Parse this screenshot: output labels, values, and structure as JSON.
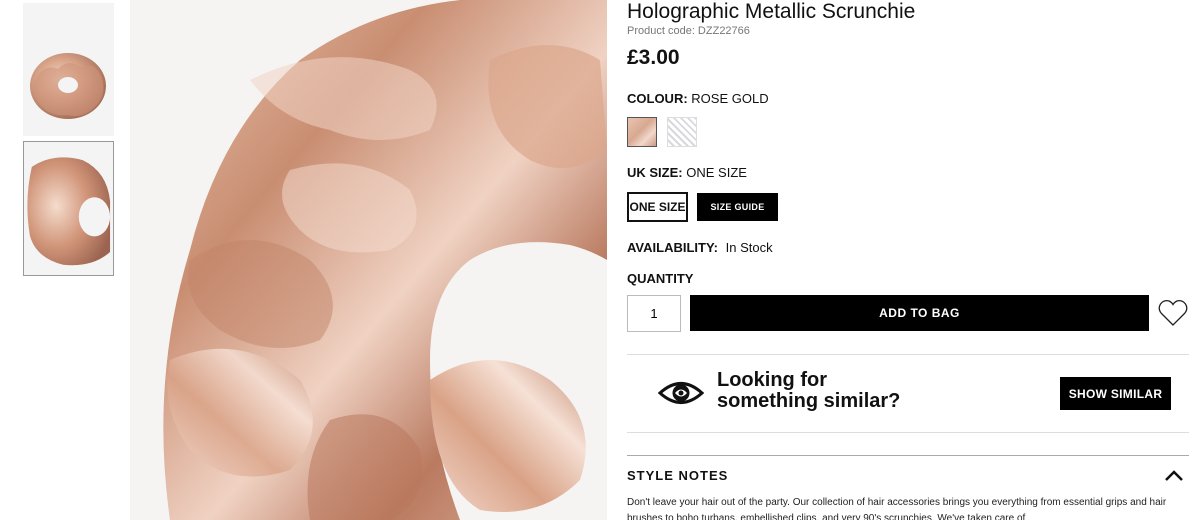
{
  "gallery": {
    "thumbnails": [
      "scrunchie-front-thumbnail",
      "scrunchie-closeup-thumbnail"
    ],
    "main_image": "scrunchie-closeup-image"
  },
  "product": {
    "title": "Holographic Metallic Scrunchie",
    "code": "Product code: DZZ22766",
    "price": "£3.00"
  },
  "colour": {
    "label": "COLOUR:",
    "value": "ROSE GOLD",
    "swatches": [
      "rose-gold",
      "white-pattern"
    ]
  },
  "size": {
    "label": "UK SIZE:",
    "value": "ONE SIZE",
    "option": "ONE SIZE",
    "guide_label": "SIZE GUIDE"
  },
  "availability": {
    "label": "AVAILABILITY:",
    "value": "In Stock"
  },
  "quantity": {
    "label": "QUANTITY",
    "value": "1"
  },
  "actions": {
    "add_to_bag": "ADD TO BAG",
    "wishlist_icon": "heart-icon"
  },
  "similar": {
    "line1": "Looking for",
    "line2": "something similar?",
    "button": "SHOW SIMILAR",
    "icon": "eye-icon"
  },
  "style_notes": {
    "heading": "STYLE NOTES",
    "text": "Don't leave your hair out of the party. Our collection of hair accessories brings you everything from essential grips and hair brushes to boho turbans, embellished clips, and very 90's scrunchies. We've taken care of"
  }
}
